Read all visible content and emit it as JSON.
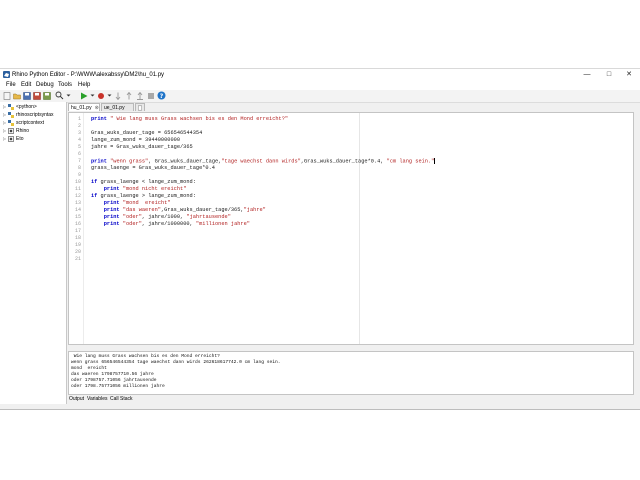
{
  "window": {
    "title": "Rhino Python Editor - P:\\WWW\\alexabssy\\DM2\\hu_01.py",
    "controls": {
      "minimize": "—",
      "maximize": "□",
      "close": "✕"
    }
  },
  "menu": [
    "File",
    "Edit",
    "Debug",
    "Tools",
    "Help"
  ],
  "sidebar": {
    "items": [
      {
        "label": "<python>"
      },
      {
        "label": "rhinoscriptsyntax"
      },
      {
        "label": "scriptcontext"
      },
      {
        "label": "Rhino"
      },
      {
        "label": "Eto"
      }
    ]
  },
  "tabs": [
    {
      "label": "hu_01.py"
    },
    {
      "label": "ue_01.py"
    }
  ],
  "editor": {
    "line_numbers": [
      "1",
      "2",
      "3",
      "4",
      "5",
      "6",
      "7",
      "8",
      "9",
      "10",
      "11",
      "12",
      "13",
      "14",
      "15",
      "16",
      "17",
      "18",
      "19",
      "20",
      "21"
    ],
    "lines": [
      {
        "a": "print",
        "b": " \" Wie lang muss Grass wachsen bis es den Mond erreicht?\""
      },
      {
        "a": "",
        "b": ""
      },
      {
        "a": "",
        "b": "Gras_wuks_dauer_tage = 656546544354"
      },
      {
        "a": "",
        "b": "lange_zum_mond = 39440000000"
      },
      {
        "a": "",
        "b": "jahre = Gras_wuks_dauer_tage/365"
      },
      {
        "a": "",
        "b": ""
      },
      {
        "a": "print",
        "b": " \"wenn grass\", Gras_wuks_dauer_tage,\"tage waechst dann wirds\",Gras_wuks_dauer_tage*0.4, \"cm lang sein.\""
      },
      {
        "a": "",
        "b": "grass_laenge = Gras_wuks_dauer_tage*0.4"
      },
      {
        "a": "",
        "b": ""
      },
      {
        "a": "if",
        "b": " grass_laenge < lange_zum_mond:"
      },
      {
        "a": "    print",
        "b": " \"mond nicht ereicht\""
      },
      {
        "a": "if",
        "b": " grass_laenge > lange_zum_mond:"
      },
      {
        "a": "    print",
        "b": " \"mond  ereicht\""
      },
      {
        "a": "    print",
        "b": " \"das waeren\",Gras_wuks_dauer_tage/365,\"jahre\""
      },
      {
        "a": "    print",
        "b": " \"oder\", jahre/1000, \"jahrtausende\""
      },
      {
        "a": "    print",
        "b": " \"oder\", jahre/1000000, \"millionen jahre\""
      }
    ]
  },
  "output": {
    "lines": [
      " Wie lang muss Grass wachsen bis es den Mond erreicht?",
      "wenn grass 656546544354 tage waechst dann wirds 262618617742.0 cm lang sein.",
      "mond  ereicht",
      "das waeren 1798757710.56 jahre",
      "oder 1798757.71056 jahrtausende",
      "oder 1798.75771056 millionen jahre"
    ]
  },
  "bottom_tabs": [
    "Output",
    "Variables",
    "Call Stack"
  ],
  "colors": {
    "keyword": "#0000c8",
    "string": "#b22222",
    "accent": "#1e73c8"
  }
}
